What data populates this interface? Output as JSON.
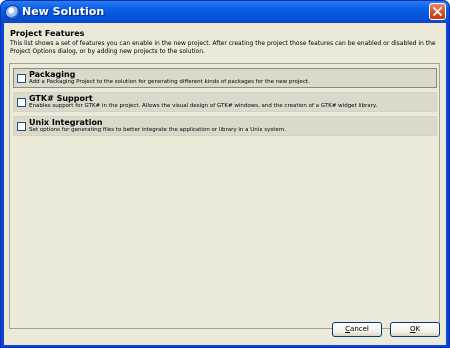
{
  "window": {
    "title": "New Solution",
    "icons": {
      "app": "monodevelop-app-icon",
      "close": "close-icon"
    }
  },
  "project_features": {
    "heading": "Project Features",
    "description": "This list shows a set of features you can enable in the new project. After creating the project those features can be enabled or disabled in the Project Options dialog, or by adding new projects to the solution."
  },
  "features": [
    {
      "name": "Packaging",
      "description": "Add a Packaging Project to the solution for generating different kinds of packages for the new project.",
      "checked": false,
      "selected": true
    },
    {
      "name": "GTK# Support",
      "description": "Enables support for GTK# in the project. Allows the visual design of GTK# windows, and the creation of a GTK# widget library.",
      "checked": false,
      "selected": false
    },
    {
      "name": "Unix Integration",
      "description": "Set options for generating files to better integrate the application or library in a Unix system.",
      "checked": false,
      "selected": false
    }
  ],
  "buttons": {
    "cancel": {
      "access_key": "C",
      "rest": "ancel"
    },
    "ok": {
      "access_key": "O",
      "rest": "K"
    }
  },
  "colors": {
    "titlebar": "#0a5ee8",
    "dialog_bg": "#ece9d8",
    "row_bg": "#dcd9cb",
    "close_button": "#d24a24"
  }
}
